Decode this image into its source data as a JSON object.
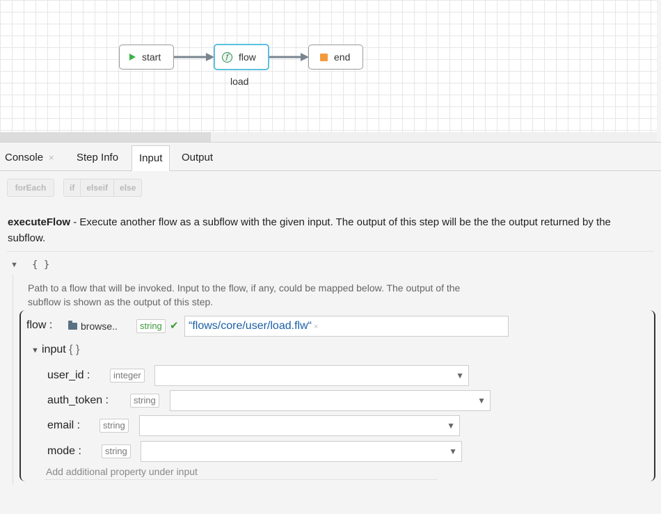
{
  "canvas": {
    "nodes": [
      {
        "label": "start",
        "icon": "play-icon"
      },
      {
        "label": "flow",
        "icon": "function-icon",
        "caption": "load",
        "selected": true
      },
      {
        "label": "end",
        "icon": "stop-icon"
      }
    ]
  },
  "tabs": [
    {
      "label": "Console",
      "closable": true
    },
    {
      "label": "Step Info"
    },
    {
      "label": "Input",
      "active": true
    },
    {
      "label": "Output"
    }
  ],
  "toolbar": {
    "foreach": "forEach",
    "if": "if",
    "elseif": "elseif",
    "else": "else"
  },
  "step": {
    "name": "executeFlow",
    "description": " - Execute another flow as a subflow with the given input. The output of this step will be the the output returned by the subflow."
  },
  "root": {
    "braces": "{ }",
    "help": "Path to a flow that will be invoked. Input to the flow, if any, could be mapped below. The output of the subflow is shown as the output of this step."
  },
  "flow_field": {
    "label": "flow :",
    "browse": "browse..",
    "type": "string",
    "value": "“flows/core/user/load.flw“"
  },
  "input_group": {
    "label": "input",
    "braces": "{ }",
    "properties": [
      {
        "label": "user_id :",
        "type": "integer",
        "value": ""
      },
      {
        "label": "auth_token :",
        "type": "string",
        "value": ""
      },
      {
        "label": "email :",
        "type": "string",
        "value": ""
      },
      {
        "label": "mode :",
        "type": "string",
        "value": ""
      }
    ],
    "add_placeholder": "Add additional property under input"
  },
  "colors": {
    "accent": "#5bc0de",
    "start": "#3cb34a",
    "end": "#f39a3a",
    "value": "#1b5fa6"
  }
}
